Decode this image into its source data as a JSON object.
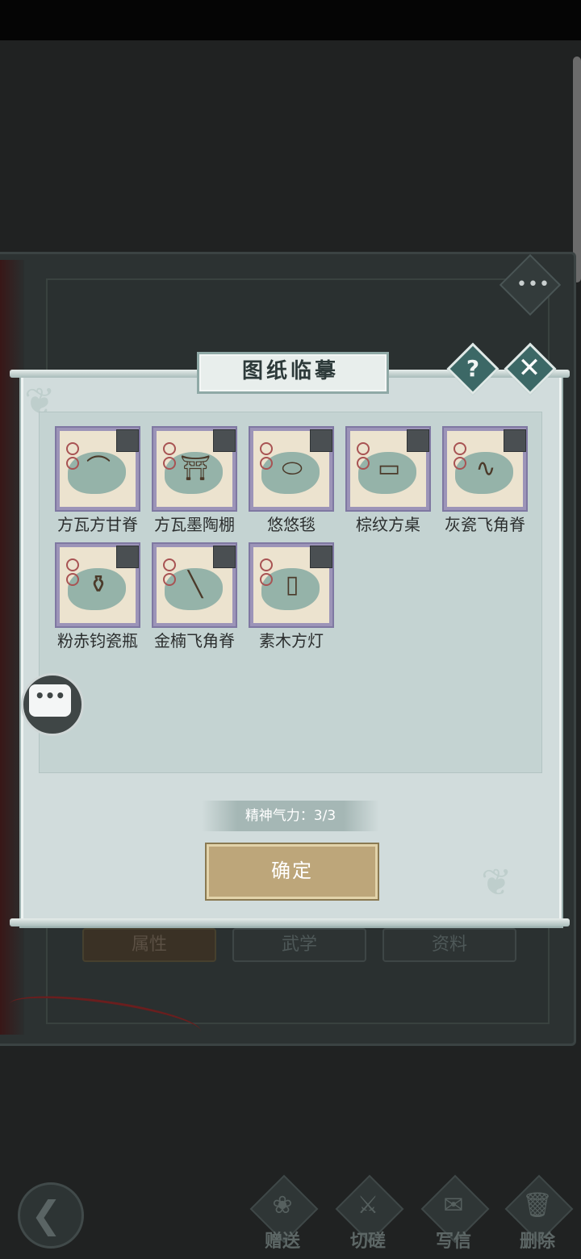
{
  "book": {
    "tabs": [
      "属性",
      "武学",
      "资料"
    ],
    "more_glyph": "•••"
  },
  "bottom_actions": [
    {
      "label": "赠送",
      "icon": "gift-scroll-icon",
      "glyph": "❀"
    },
    {
      "label": "切磋",
      "icon": "sword-icon",
      "glyph": "⚔"
    },
    {
      "label": "写信",
      "icon": "letter-icon",
      "glyph": "✉"
    },
    {
      "label": "删除",
      "icon": "trash-icon",
      "glyph": "🗑"
    }
  ],
  "back_glyph": "❮",
  "modal": {
    "title": "图纸临摹",
    "help_glyph": "?",
    "close_glyph": "✕",
    "items": [
      {
        "name": "方瓦方甘脊",
        "icon": "roof-ridge-icon",
        "glyph": "⌒"
      },
      {
        "name": "方瓦墨陶棚",
        "icon": "canopy-icon",
        "glyph": "⛩"
      },
      {
        "name": "悠悠毯",
        "icon": "rug-icon",
        "glyph": "⬭"
      },
      {
        "name": "棕纹方桌",
        "icon": "table-icon",
        "glyph": "▭"
      },
      {
        "name": "灰瓷飞角脊",
        "icon": "eave-ridge-icon",
        "glyph": "∿"
      },
      {
        "name": "粉赤钧瓷瓶",
        "icon": "vase-icon",
        "glyph": "⚱"
      },
      {
        "name": "金楠飞角脊",
        "icon": "wood-ridge-icon",
        "glyph": "╲"
      },
      {
        "name": "素木方灯",
        "icon": "lantern-icon",
        "glyph": "▯"
      }
    ],
    "spirit": "精神气力：3/3",
    "confirm": "确定"
  },
  "chat_glyph": "•••",
  "colors": {
    "accent": "#3c6866",
    "gold": "#bda67a",
    "card_border": "#7f78a2"
  }
}
